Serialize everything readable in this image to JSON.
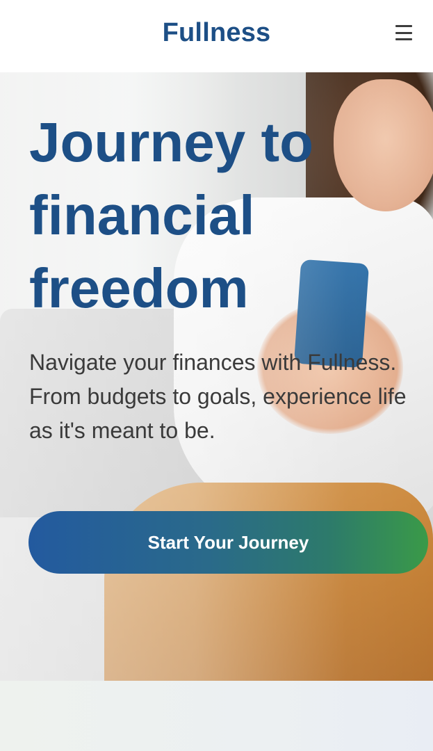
{
  "header": {
    "brand": "Fullness",
    "menu_icon": "hamburger-menu-icon"
  },
  "hero": {
    "title": "Journey to financial freedom",
    "subtitle": "Navigate your finances with Fullness. From budgets to goals, experience life as it's meant to be.",
    "cta_label": "Start Your Journey"
  },
  "colors": {
    "brand": "#1d4f86",
    "cta_gradient_start": "#235a9f",
    "cta_gradient_end": "#3a9a48",
    "body_text": "#3a3a3a"
  }
}
